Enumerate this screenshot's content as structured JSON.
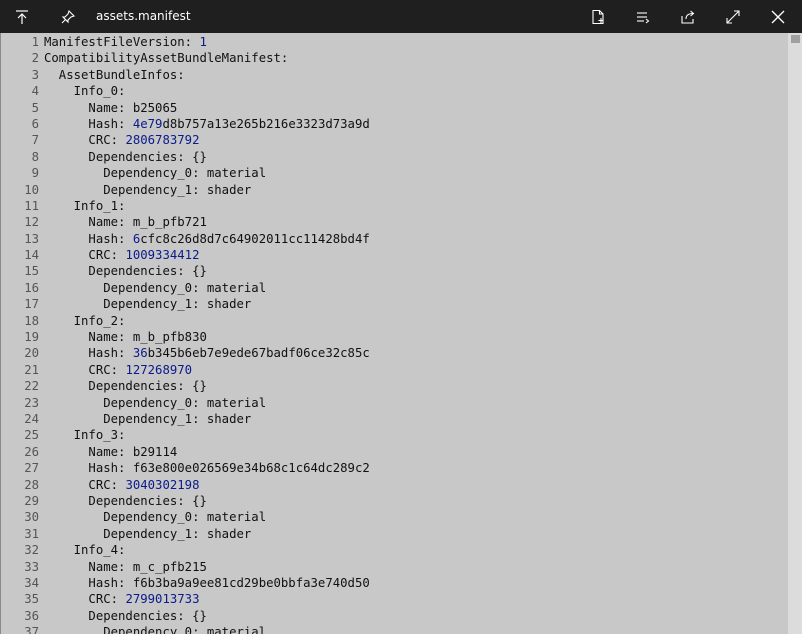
{
  "titlebar": {
    "file_name": "assets.manifest"
  },
  "icons": {
    "top_left": "align-top-icon",
    "pin": "pin-icon",
    "new_file": "new-file-icon",
    "list": "list-icon",
    "share": "share-icon",
    "fullscreen": "expand-icon",
    "close": "close-icon"
  },
  "colors": {
    "titlebar_bg": "#1f1f1f",
    "editor_bg": "#c8c8c8",
    "number_color": "#0a1a8a"
  },
  "editor": {
    "lines": [
      {
        "n": "1",
        "pre": "ManifestFileVersion: ",
        "val": "1",
        "post": ""
      },
      {
        "n": "2",
        "pre": "CompatibilityAssetBundleManifest:",
        "val": "",
        "post": ""
      },
      {
        "n": "3",
        "pre": "  AssetBundleInfos:",
        "val": "",
        "post": ""
      },
      {
        "n": "4",
        "pre": "    Info_0:",
        "val": "",
        "post": ""
      },
      {
        "n": "5",
        "pre": "      Name: b25065",
        "val": "",
        "post": ""
      },
      {
        "n": "6",
        "pre": "      Hash: ",
        "val": "4e79",
        "post": "d8b757a13e265b216e3323d73a9d"
      },
      {
        "n": "7",
        "pre": "      CRC: ",
        "val": "2806783792",
        "post": ""
      },
      {
        "n": "8",
        "pre": "      Dependencies: {}",
        "val": "",
        "post": ""
      },
      {
        "n": "9",
        "pre": "        Dependency_0: material",
        "val": "",
        "post": ""
      },
      {
        "n": "10",
        "pre": "        Dependency_1: shader",
        "val": "",
        "post": ""
      },
      {
        "n": "11",
        "pre": "    Info_1:",
        "val": "",
        "post": ""
      },
      {
        "n": "12",
        "pre": "      Name: m_b_pfb721",
        "val": "",
        "post": ""
      },
      {
        "n": "13",
        "pre": "      Hash: ",
        "val": "6",
        "post": "cfc8c26d8d7c64902011cc11428bd4f"
      },
      {
        "n": "14",
        "pre": "      CRC: ",
        "val": "1009334412",
        "post": ""
      },
      {
        "n": "15",
        "pre": "      Dependencies: {}",
        "val": "",
        "post": ""
      },
      {
        "n": "16",
        "pre": "        Dependency_0: material",
        "val": "",
        "post": ""
      },
      {
        "n": "17",
        "pre": "        Dependency_1: shader",
        "val": "",
        "post": ""
      },
      {
        "n": "18",
        "pre": "    Info_2:",
        "val": "",
        "post": ""
      },
      {
        "n": "19",
        "pre": "      Name: m_b_pfb830",
        "val": "",
        "post": ""
      },
      {
        "n": "20",
        "pre": "      Hash: ",
        "val": "36",
        "post": "b345b6eb7e9ede67badf06ce32c85c"
      },
      {
        "n": "21",
        "pre": "      CRC: ",
        "val": "127268970",
        "post": ""
      },
      {
        "n": "22",
        "pre": "      Dependencies: {}",
        "val": "",
        "post": ""
      },
      {
        "n": "23",
        "pre": "        Dependency_0: material",
        "val": "",
        "post": ""
      },
      {
        "n": "24",
        "pre": "        Dependency_1: shader",
        "val": "",
        "post": ""
      },
      {
        "n": "25",
        "pre": "    Info_3:",
        "val": "",
        "post": ""
      },
      {
        "n": "26",
        "pre": "      Name: b29114",
        "val": "",
        "post": ""
      },
      {
        "n": "27",
        "pre": "      Hash: f63e800e026569e34b68c1c64dc289c2",
        "val": "",
        "post": ""
      },
      {
        "n": "28",
        "pre": "      CRC: ",
        "val": "3040302198",
        "post": ""
      },
      {
        "n": "29",
        "pre": "      Dependencies: {}",
        "val": "",
        "post": ""
      },
      {
        "n": "30",
        "pre": "        Dependency_0: material",
        "val": "",
        "post": ""
      },
      {
        "n": "31",
        "pre": "        Dependency_1: shader",
        "val": "",
        "post": ""
      },
      {
        "n": "32",
        "pre": "    Info_4:",
        "val": "",
        "post": ""
      },
      {
        "n": "33",
        "pre": "      Name: m_c_pfb215",
        "val": "",
        "post": ""
      },
      {
        "n": "34",
        "pre": "      Hash: f6b3ba9a9ee81cd29be0bbfa3e740d50",
        "val": "",
        "post": ""
      },
      {
        "n": "35",
        "pre": "      CRC: ",
        "val": "2799013733",
        "post": ""
      },
      {
        "n": "36",
        "pre": "      Dependencies: {}",
        "val": "",
        "post": ""
      },
      {
        "n": "37",
        "pre": "        Dependency_0: material",
        "val": "",
        "post": ""
      }
    ]
  }
}
